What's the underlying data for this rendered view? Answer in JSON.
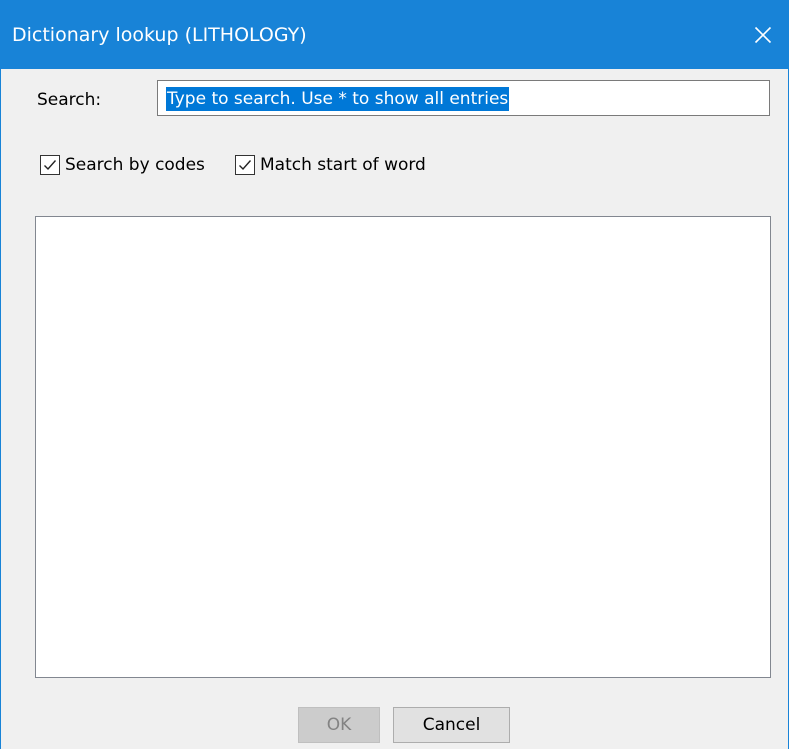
{
  "window": {
    "title": "Dictionary lookup (LITHOLOGY)",
    "close_icon": "close-icon",
    "titlebar_color": "#1883d7"
  },
  "search": {
    "label": "Search:",
    "value": "Type to search. Use * to show all entries",
    "value_selected": true
  },
  "options": {
    "search_by_codes": {
      "label": "Search by codes",
      "checked": true
    },
    "match_start_of_word": {
      "label": "Match start of word",
      "checked": true
    }
  },
  "results": {
    "items": []
  },
  "buttons": {
    "ok_label": "OK",
    "ok_enabled": false,
    "cancel_label": "Cancel"
  }
}
